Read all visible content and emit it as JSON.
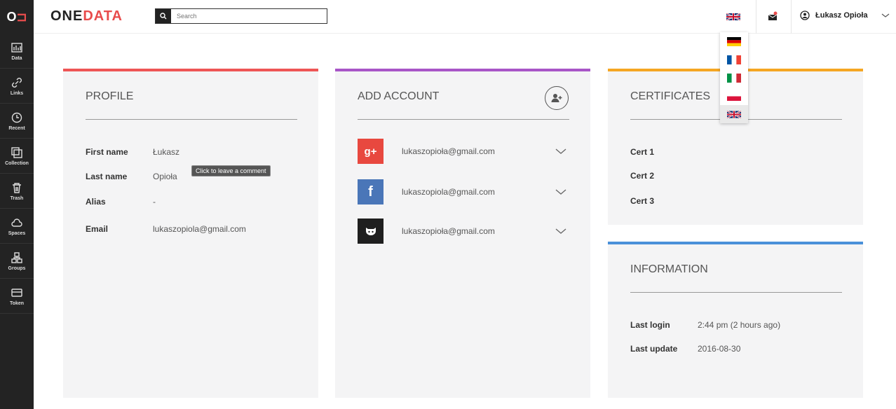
{
  "sidebar": {
    "logo": "O",
    "logo_accent": "⊐",
    "items": [
      {
        "label": "Data",
        "icon": "data-icon"
      },
      {
        "label": "Links",
        "icon": "link-icon"
      },
      {
        "label": "Recent",
        "icon": "clock-icon"
      },
      {
        "label": "Collection",
        "icon": "collection-icon"
      },
      {
        "label": "Trash",
        "icon": "trash-icon"
      },
      {
        "label": "Spaces",
        "icon": "cloud-icon"
      },
      {
        "label": "Groups",
        "icon": "groups-icon"
      },
      {
        "label": "Token",
        "icon": "token-icon"
      }
    ]
  },
  "header": {
    "brand_part1": "ONE",
    "brand_part2": "DATA",
    "search_placeholder": "Search",
    "user_name": "Łukasz Opioła"
  },
  "languages": [
    "de",
    "fr",
    "it",
    "pl",
    "gb"
  ],
  "selected_language": "gb",
  "profile": {
    "title": "PROFILE",
    "fields": [
      {
        "key": "First name",
        "value": "Łukasz"
      },
      {
        "key": "Last name",
        "value": "Opioła"
      },
      {
        "key": "Alias",
        "value": "-"
      },
      {
        "key": "Email",
        "value": "lukaszopiola@gmail.com"
      }
    ],
    "tooltip": "Click to leave a comment"
  },
  "add_account": {
    "title": "ADD ACCOUNT",
    "accounts": [
      {
        "provider": "google-plus",
        "email": "lukaszopioła@gmail.com"
      },
      {
        "provider": "facebook",
        "email": "lukaszopiola@gmail.com"
      },
      {
        "provider": "github",
        "email": "lukaszopioła@gmail.com"
      }
    ]
  },
  "certificates": {
    "title": "CERTIFICATES",
    "items": [
      "Cert 1",
      "Cert 2",
      "Cert 3"
    ]
  },
  "information": {
    "title": "INFORMATION",
    "fields": [
      {
        "key": "Last login",
        "value": "2:44 pm (2 hours ago)"
      },
      {
        "key": "Last update",
        "value": "2016-08-30"
      }
    ]
  },
  "colors": {
    "profile_accent": "#ee5555",
    "account_accent": "#a855c7",
    "cert_accent": "#f5a623",
    "info_accent": "#4a90d9",
    "google": "#e8483f",
    "facebook": "#4a76b8",
    "github": "#1f1f1f"
  }
}
